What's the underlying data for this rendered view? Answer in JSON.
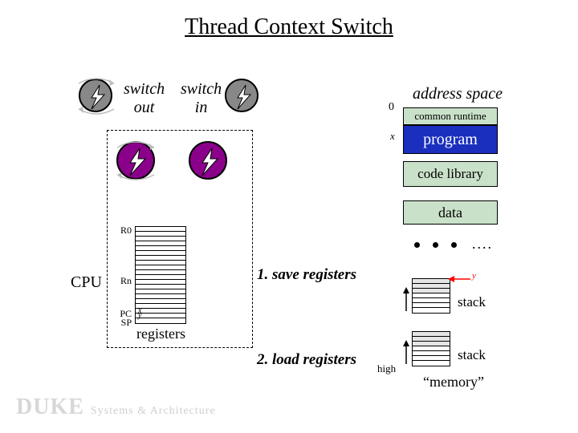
{
  "title": "Thread Context Switch",
  "labels": {
    "switch_out": "switch\nout",
    "switch_in": "switch\nin",
    "address_space": "address space",
    "zero": "0",
    "x": "x",
    "high": "high",
    "cpu": "CPU",
    "registers": "registers",
    "step1": "1. save registers",
    "step2": "2. load registers",
    "memory_quote": "“memory”",
    "r0": "R0",
    "rn": "Rn",
    "pc": "PC",
    "sp": "SP",
    "pc_val": "x",
    "sp_val": "y",
    "y_mark": "y"
  },
  "memory": {
    "common_runtime": "common runtime",
    "program": "program",
    "code_library": "code library",
    "data": "data",
    "stack": "stack"
  },
  "footer": {
    "brand": "DUKE",
    "sub": "Systems & Architecture"
  }
}
